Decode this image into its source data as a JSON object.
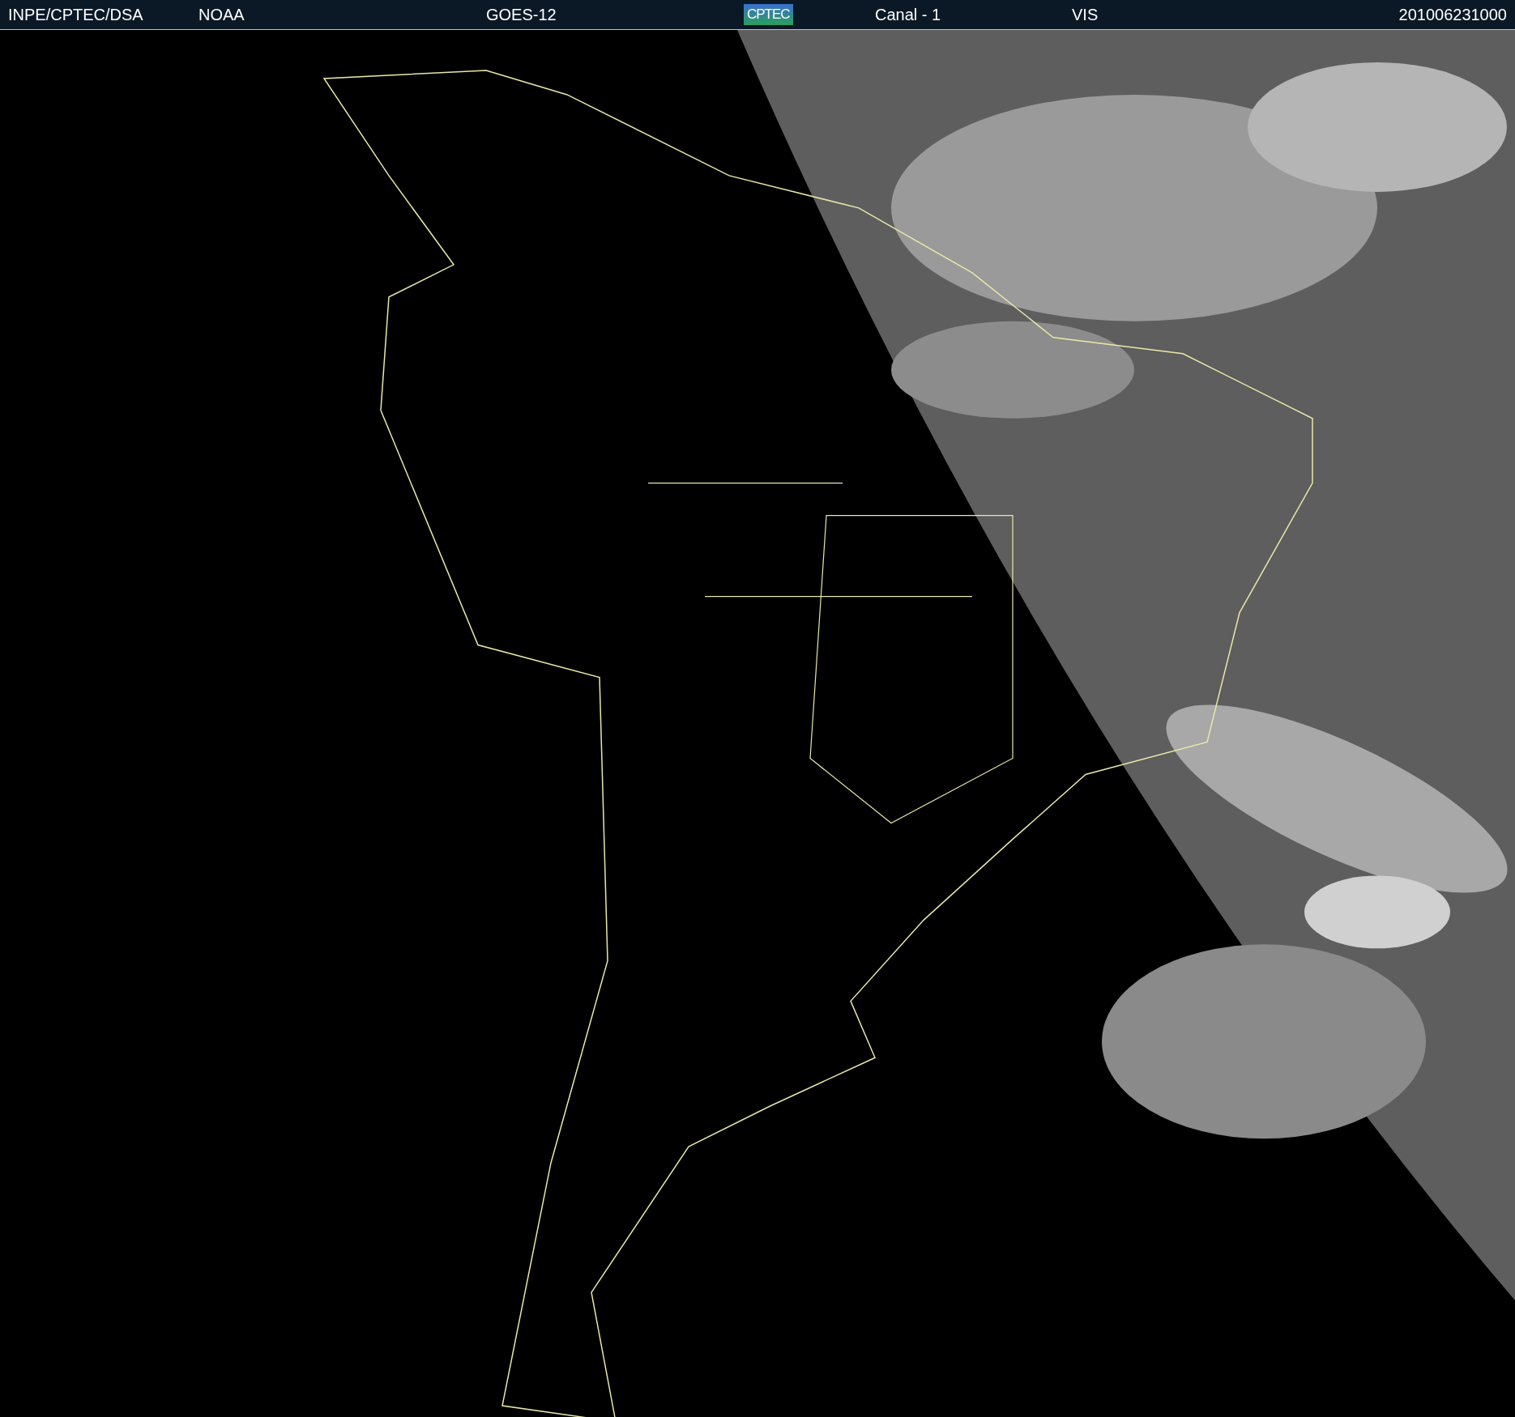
{
  "header": {
    "items": [
      {
        "kind": "text",
        "text": "INPE/CPTEC/DSA"
      },
      {
        "kind": "text",
        "text": "NOAA"
      },
      {
        "kind": "text",
        "text": "GOES-12"
      },
      {
        "kind": "logo",
        "text": "CPTEC"
      },
      {
        "kind": "text",
        "text": "Canal - 1"
      },
      {
        "kind": "text",
        "text": "VIS"
      },
      {
        "kind": "text",
        "text": "201006231000"
      }
    ]
  }
}
